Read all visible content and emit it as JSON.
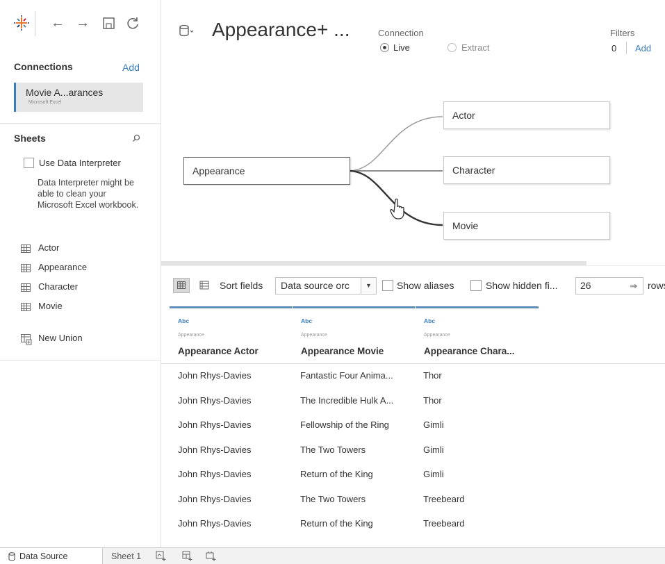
{
  "left_pane": {
    "connections_title": "Connections",
    "add_label": "Add",
    "connection": {
      "name": "Movie A...arances",
      "type": "Microsoft Excel"
    },
    "sheets_title": "Sheets",
    "data_interpreter": {
      "label": "Use Data Interpreter",
      "description": "Data Interpreter might be able to clean your Microsoft Excel workbook."
    },
    "sheets": [
      "Actor",
      "Appearance",
      "Character",
      "Movie"
    ],
    "new_union": "New Union"
  },
  "header": {
    "title": "Appearance+ ...",
    "connection_label": "Connection",
    "live_label": "Live",
    "extract_label": "Extract",
    "connection_mode": "Live",
    "filters_label": "Filters",
    "filters_count": "0",
    "filters_add": "Add"
  },
  "canvas": {
    "main_table": "Appearance",
    "joined_tables": [
      "Actor",
      "Character",
      "Movie"
    ]
  },
  "grid_toolbar": {
    "sort_label": "Sort fields",
    "sort_value": "Data source orc",
    "show_aliases": "Show aliases",
    "show_hidden": "Show hidden fi...",
    "rows_value": "26",
    "rows_label": "rows"
  },
  "grid": {
    "columns": [
      {
        "type": "Abc",
        "source": "Appearance",
        "name": "Appearance Actor"
      },
      {
        "type": "Abc",
        "source": "Appearance",
        "name": "Appearance Movie"
      },
      {
        "type": "Abc",
        "source": "Appearance",
        "name": "Appearance Chara..."
      }
    ],
    "rows": [
      [
        "John Rhys-Davies",
        "Fantastic Four Anima...",
        "Thor"
      ],
      [
        "John Rhys-Davies",
        "The Incredible Hulk A...",
        "Thor"
      ],
      [
        "John Rhys-Davies",
        "Fellowship of the Ring",
        "Gimli"
      ],
      [
        "John Rhys-Davies",
        "The Two Towers",
        "Gimli"
      ],
      [
        "John Rhys-Davies",
        "Return of the King",
        "Gimli"
      ],
      [
        "John Rhys-Davies",
        "The Two Towers",
        "Treebeard"
      ],
      [
        "John Rhys-Davies",
        "Return of the King",
        "Treebeard"
      ]
    ]
  },
  "bottom_tabs": {
    "data_source": "Data Source",
    "sheet1": "Sheet 1"
  },
  "colors": {
    "accent_blue": "#3a7dbd",
    "column_bar": "#5f8db8",
    "connection_bg": "#e6e6e6"
  }
}
